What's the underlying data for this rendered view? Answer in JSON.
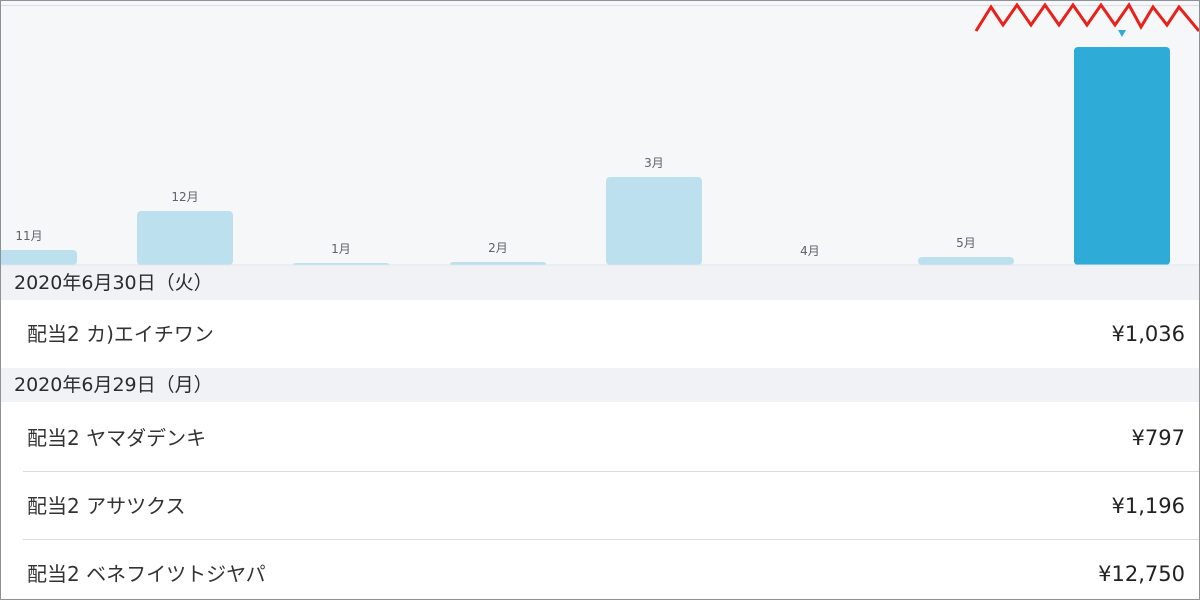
{
  "chart_data": {
    "type": "bar",
    "categories": [
      "11月",
      "12月",
      "1月",
      "2月",
      "3月",
      "4月",
      "5月",
      ""
    ],
    "values": [
      15,
      54,
      2,
      3,
      88,
      0,
      8,
      218
    ],
    "ylim": [
      0,
      260
    ],
    "grid": false,
    "legend": "none",
    "highlighted_index": 7,
    "colors": {
      "bar": "#bde0ef",
      "highlight": "#2eabd6",
      "marker": "#2eabd6",
      "burst": "#e8211b"
    }
  },
  "sections": [
    {
      "date": "2020年6月30日（火）",
      "items": [
        {
          "label": "配当2 カ)エイチワン",
          "amount": "¥1,036"
        }
      ]
    },
    {
      "date": "2020年6月29日（月）",
      "items": [
        {
          "label": "配当2 ヤマダデンキ",
          "amount": "¥797"
        },
        {
          "label": "配当2 アサツクス",
          "amount": "¥1,196"
        },
        {
          "label": "配当2 ベネフイツトジヤパ",
          "amount": "¥12,750"
        }
      ]
    }
  ]
}
